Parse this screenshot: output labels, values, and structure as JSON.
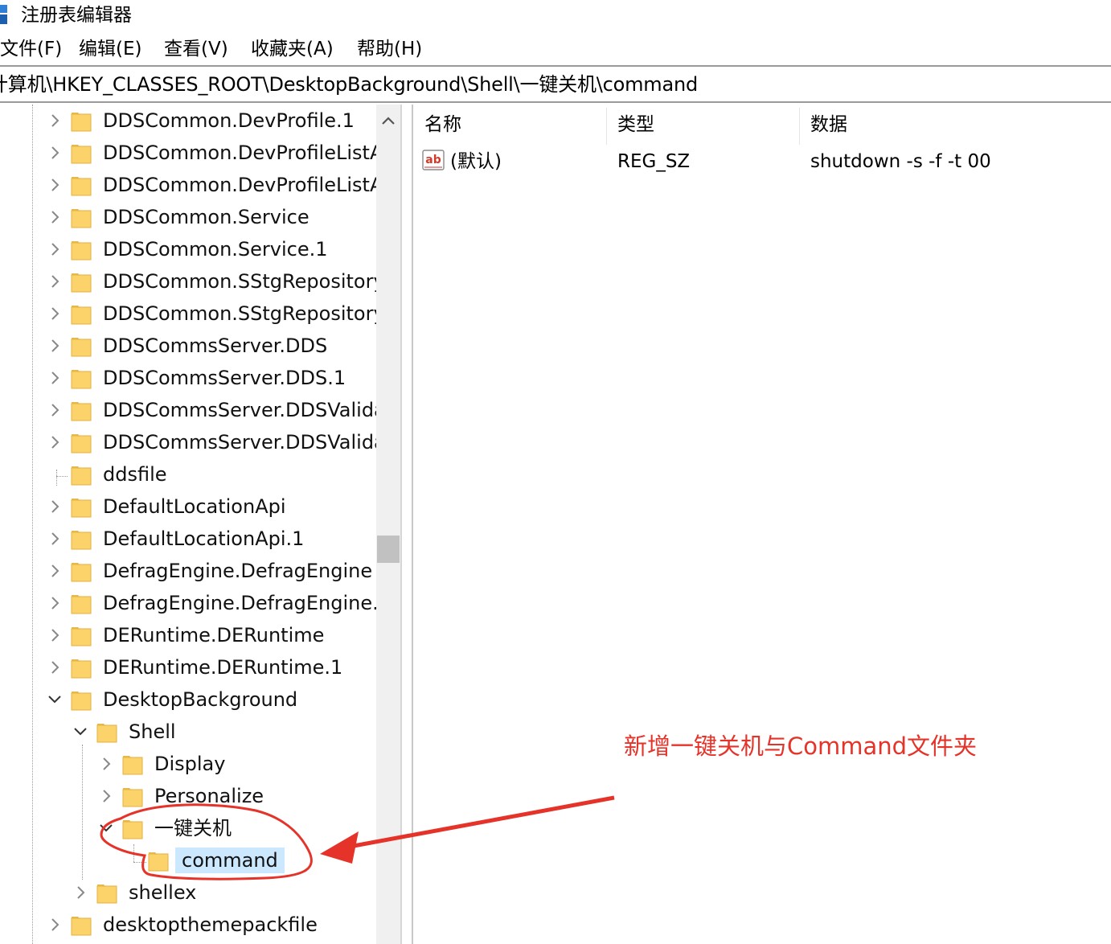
{
  "window": {
    "title": "注册表编辑器"
  },
  "menu": [
    "文件(F)",
    "编辑(E)",
    "查看(V)",
    "收藏夹(A)",
    "帮助(H)"
  ],
  "address": "计算机\\HKEY_CLASSES_ROOT\\DesktopBackground\\Shell\\一键关机\\command",
  "tree": {
    "nodes": [
      {
        "label": "DDSCommon.DevProfile.1",
        "depth": 0,
        "expander": "collapsed"
      },
      {
        "label": "DDSCommon.DevProfileListA",
        "depth": 0,
        "expander": "collapsed"
      },
      {
        "label": "DDSCommon.DevProfileListA",
        "depth": 0,
        "expander": "collapsed"
      },
      {
        "label": "DDSCommon.Service",
        "depth": 0,
        "expander": "collapsed"
      },
      {
        "label": "DDSCommon.Service.1",
        "depth": 0,
        "expander": "collapsed"
      },
      {
        "label": "DDSCommon.SStgRepository",
        "depth": 0,
        "expander": "collapsed"
      },
      {
        "label": "DDSCommon.SStgRepository",
        "depth": 0,
        "expander": "collapsed"
      },
      {
        "label": "DDSCommsServer.DDS",
        "depth": 0,
        "expander": "collapsed"
      },
      {
        "label": "DDSCommsServer.DDS.1",
        "depth": 0,
        "expander": "collapsed"
      },
      {
        "label": "DDSCommsServer.DDSValida",
        "depth": 0,
        "expander": "collapsed"
      },
      {
        "label": "DDSCommsServer.DDSValida",
        "depth": 0,
        "expander": "collapsed"
      },
      {
        "label": "ddsfile",
        "depth": 0,
        "expander": "none"
      },
      {
        "label": "DefaultLocationApi",
        "depth": 0,
        "expander": "collapsed"
      },
      {
        "label": "DefaultLocationApi.1",
        "depth": 0,
        "expander": "collapsed"
      },
      {
        "label": "DefragEngine.DefragEngine",
        "depth": 0,
        "expander": "collapsed"
      },
      {
        "label": "DefragEngine.DefragEngine.1",
        "depth": 0,
        "expander": "collapsed"
      },
      {
        "label": "DERuntime.DERuntime",
        "depth": 0,
        "expander": "collapsed"
      },
      {
        "label": "DERuntime.DERuntime.1",
        "depth": 0,
        "expander": "collapsed"
      },
      {
        "label": "DesktopBackground",
        "depth": 0,
        "expander": "expanded"
      },
      {
        "label": "Shell",
        "depth": 1,
        "expander": "expanded"
      },
      {
        "label": "Display",
        "depth": 2,
        "expander": "collapsed"
      },
      {
        "label": "Personalize",
        "depth": 2,
        "expander": "collapsed"
      },
      {
        "label": "一键关机",
        "depth": 2,
        "expander": "expanded"
      },
      {
        "label": "command",
        "depth": 3,
        "expander": "none",
        "selected": true
      },
      {
        "label": "shellex",
        "depth": 1,
        "expander": "collapsed"
      },
      {
        "label": "desktopthemepackfile",
        "depth": 0,
        "expander": "collapsed"
      }
    ]
  },
  "list": {
    "columns": [
      "名称",
      "类型",
      "数据"
    ],
    "rows": [
      {
        "name": "(默认)",
        "type": "REG_SZ",
        "data": "shutdown -s -f -t 00",
        "icon": "string-value-icon"
      }
    ]
  },
  "annotation": {
    "text": "新增一键关机与Command文件夹",
    "color": "#e5332a"
  },
  "colors": {
    "selection": "#cce8ff",
    "folder": "#fbd36a",
    "scroll_track": "#f0f0f0",
    "scroll_thumb": "#c1c1c1"
  }
}
